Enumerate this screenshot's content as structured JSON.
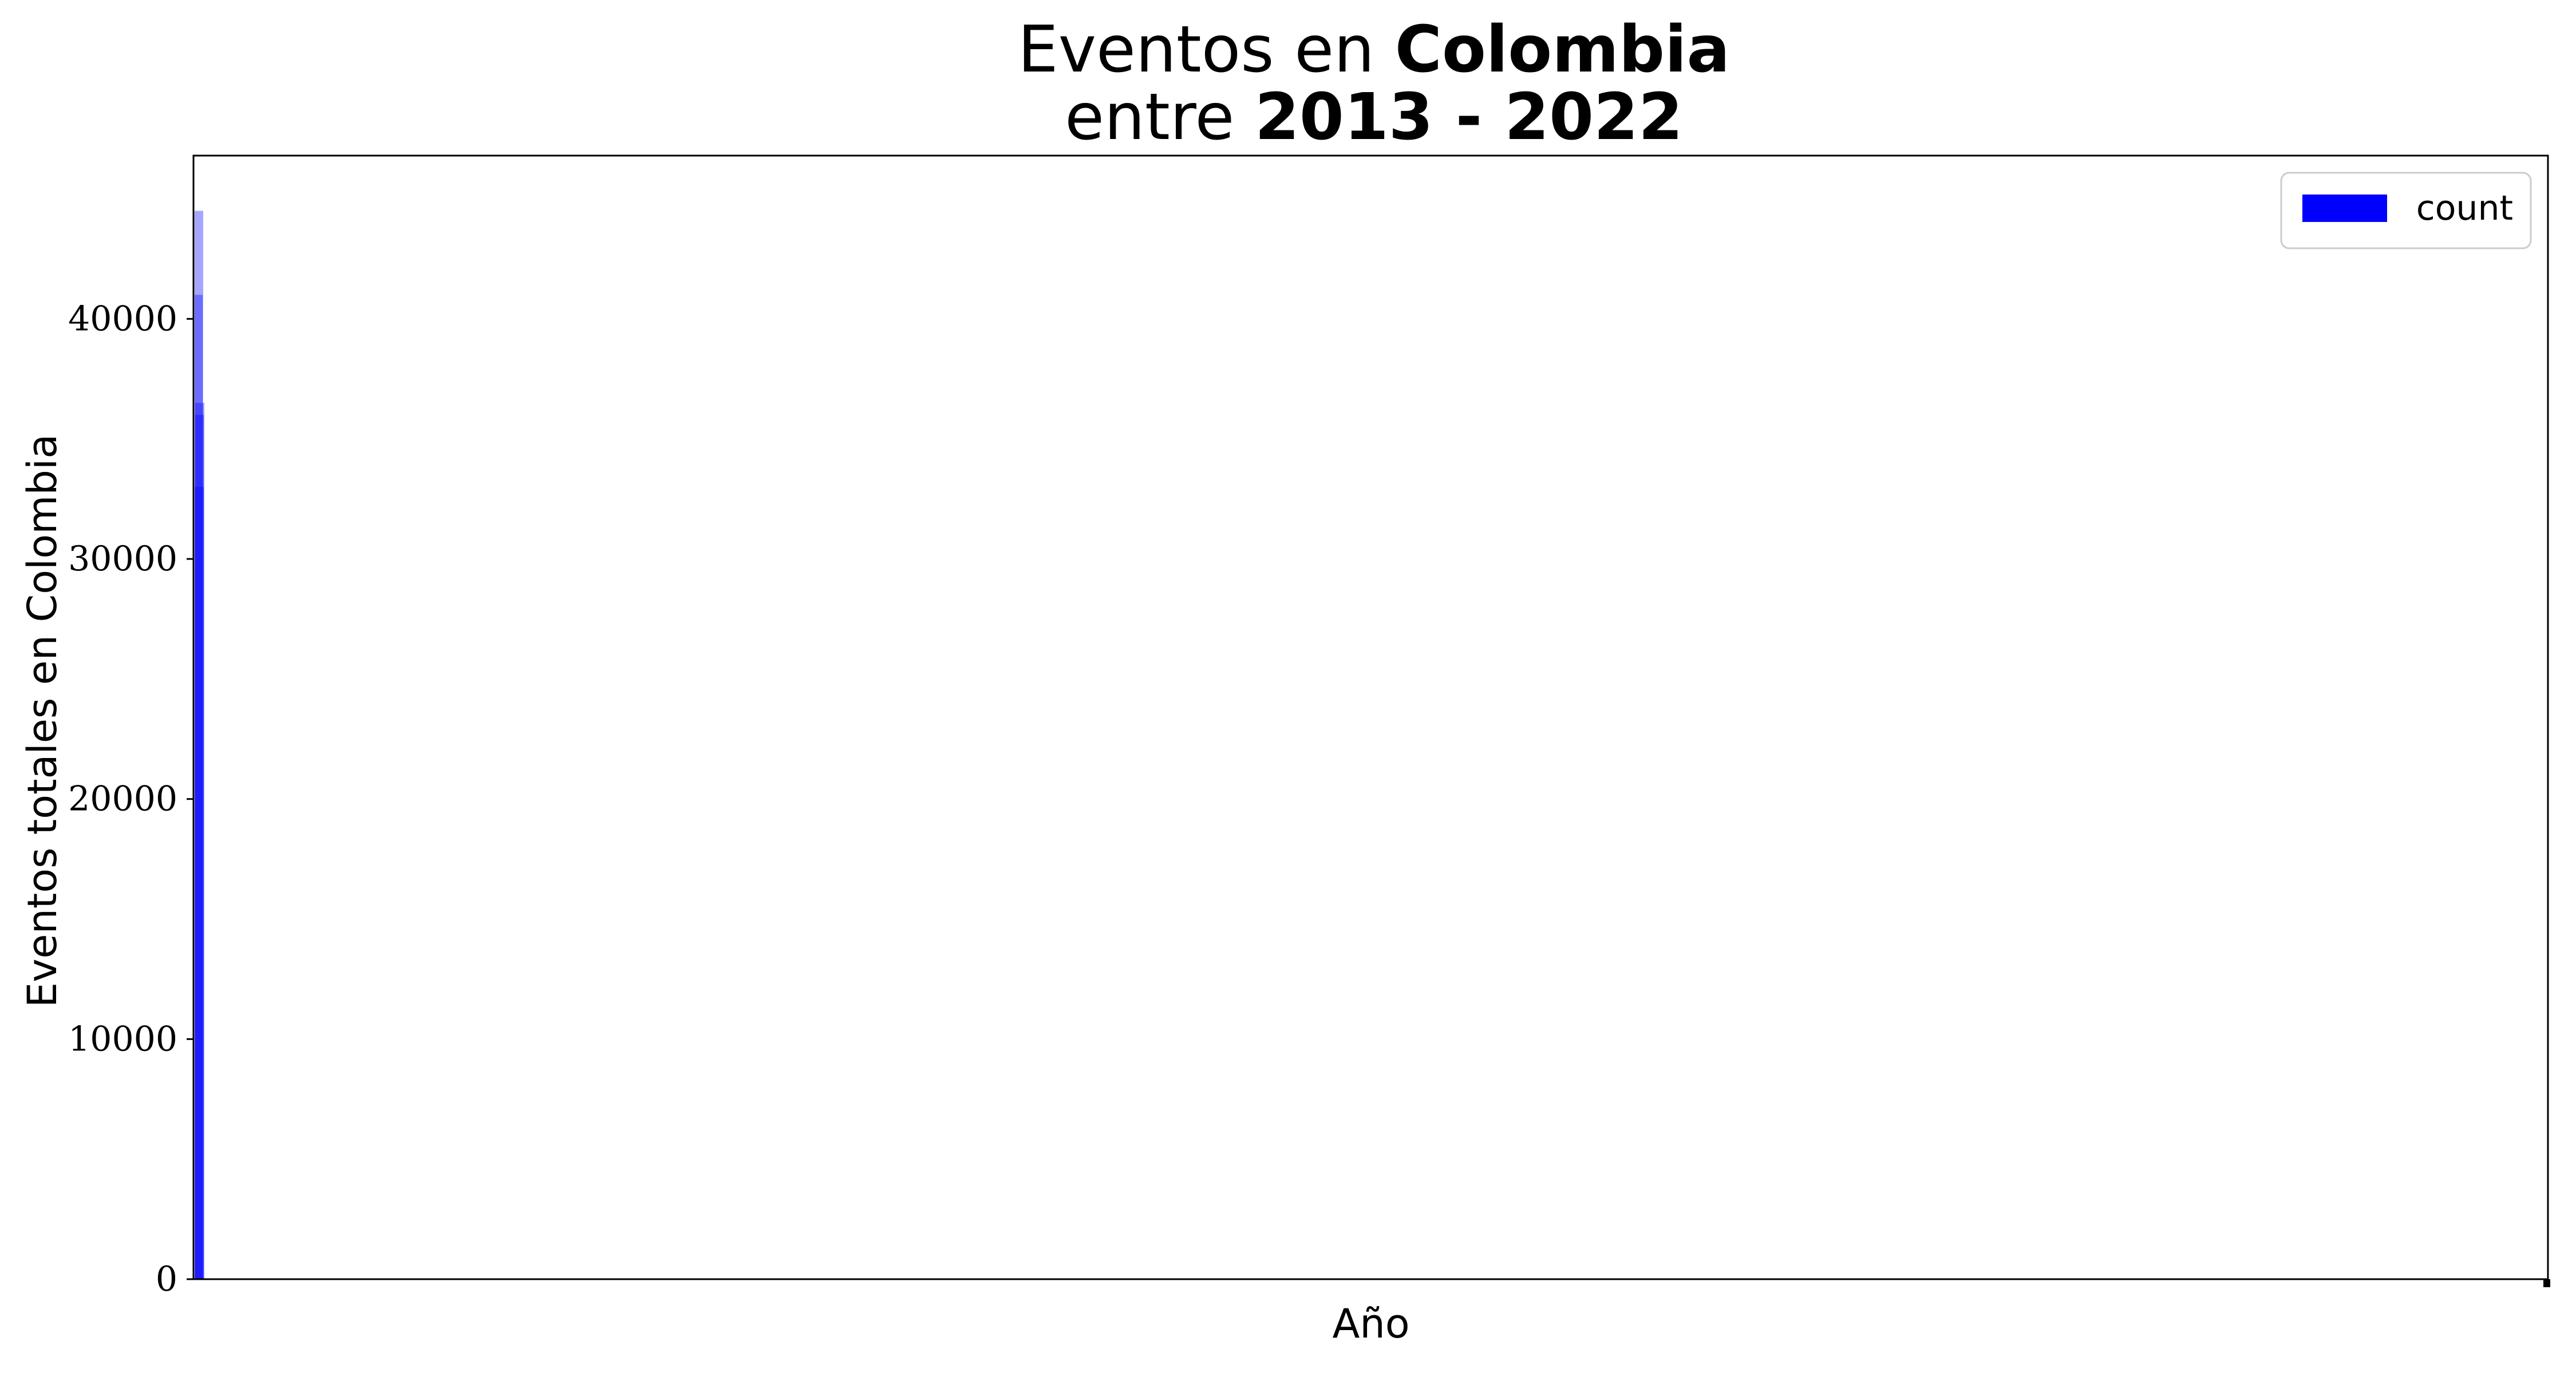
{
  "chart_data": {
    "type": "bar",
    "title": {
      "line1_prefix": "Eventos en ",
      "line1_bold": "Colombia",
      "line2_prefix": "entre ",
      "line2_bold": "2013 - 2022"
    },
    "xlabel": "Año",
    "ylabel": "Eventos totales en Colombia",
    "ylim": [
      0,
      46800
    ],
    "yticks": [
      0,
      10000,
      20000,
      30000,
      40000
    ],
    "grid": false,
    "legend": {
      "position": "top-right",
      "entries": [
        {
          "label": "count",
          "color": "#0000ff"
        }
      ]
    },
    "series": [
      {
        "name": "count",
        "color": "#0000ff",
        "values": [
          33000,
          36000,
          41000,
          36500,
          44500
        ]
      }
    ]
  }
}
